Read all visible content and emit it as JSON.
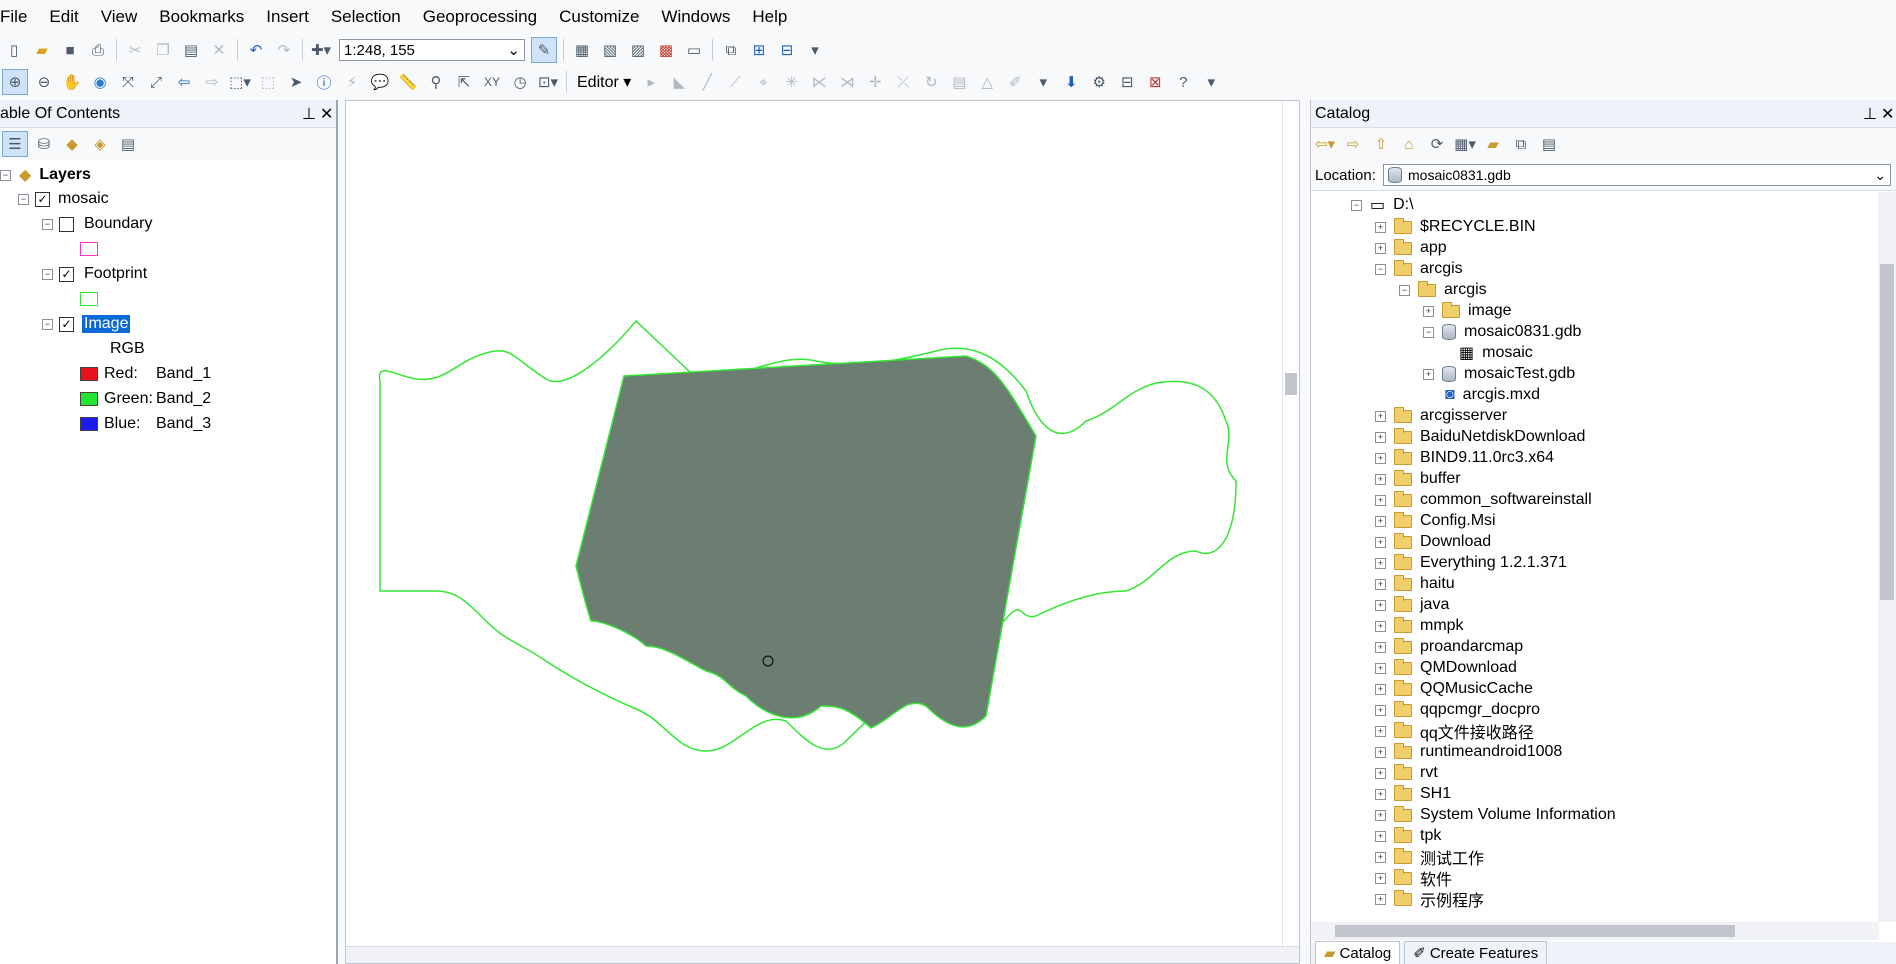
{
  "menu": [
    "File",
    "Edit",
    "View",
    "Bookmarks",
    "Insert",
    "Selection",
    "Geoprocessing",
    "Customize",
    "Windows",
    "Help"
  ],
  "toolbar": {
    "scale": "1:248, 155",
    "editor_label": "Editor"
  },
  "toc": {
    "title": "able Of Contents",
    "layers_label": "Layers",
    "mosaic": "mosaic",
    "boundary": "Boundary",
    "footprint": "Footprint",
    "image": "Image",
    "rgb": "RGB",
    "bands": [
      {
        "label": "Red:",
        "band": "Band_1",
        "color": "#e8101a"
      },
      {
        "label": "Green:",
        "band": "Band_2",
        "color": "#22e630"
      },
      {
        "label": "Blue:",
        "band": "Band_3",
        "color": "#1a1aee"
      }
    ],
    "boundary_color": "#ff33cc",
    "footprint_color": "#33e633"
  },
  "catalog": {
    "title": "Catalog",
    "location_label": "Location:",
    "location_value": "mosaic0831.gdb",
    "tree": [
      {
        "label": "D:\\",
        "type": "drive"
      },
      {
        "label": "$RECYCLE.BIN",
        "type": "folder"
      },
      {
        "label": "app",
        "type": "folder"
      },
      {
        "label": "arcgis",
        "type": "folder"
      },
      {
        "label": "arcgis",
        "type": "folder"
      },
      {
        "label": "image",
        "type": "folder"
      },
      {
        "label": "mosaic0831.gdb",
        "type": "gdb"
      },
      {
        "label": "mosaic",
        "type": "mosaic"
      },
      {
        "label": "mosaicTest.gdb",
        "type": "gdb"
      },
      {
        "label": "arcgis.mxd",
        "type": "mxd"
      },
      {
        "label": "arcgisserver",
        "type": "folder"
      },
      {
        "label": "BaiduNetdiskDownload",
        "type": "folder"
      },
      {
        "label": "BIND9.11.0rc3.x64",
        "type": "folder"
      },
      {
        "label": "buffer",
        "type": "folder"
      },
      {
        "label": "common_softwareinstall",
        "type": "folder"
      },
      {
        "label": "Config.Msi",
        "type": "folder"
      },
      {
        "label": "Download",
        "type": "folder"
      },
      {
        "label": "Everything 1.2.1.371",
        "type": "folder"
      },
      {
        "label": "haitu",
        "type": "folder"
      },
      {
        "label": "java",
        "type": "folder"
      },
      {
        "label": "mmpk",
        "type": "folder"
      },
      {
        "label": "proandarcmap",
        "type": "folder"
      },
      {
        "label": "QMDownload",
        "type": "folder"
      },
      {
        "label": "QQMusicCache",
        "type": "folder"
      },
      {
        "label": "qqpcmgr_docpro",
        "type": "folder"
      },
      {
        "label": "qq文件接收路径",
        "type": "folder"
      },
      {
        "label": "runtimeandroid1008",
        "type": "folder"
      },
      {
        "label": "rvt",
        "type": "folder"
      },
      {
        "label": "SH1",
        "type": "folder"
      },
      {
        "label": "System Volume Information",
        "type": "folder"
      },
      {
        "label": "tpk",
        "type": "folder"
      },
      {
        "label": "测试工作",
        "type": "folder"
      },
      {
        "label": "软件",
        "type": "folder"
      },
      {
        "label": "示例程序",
        "type": "folder"
      }
    ],
    "tab_catalog": "Catalog",
    "tab_create": "Create Features"
  },
  "colors": {
    "selection": "#0a6ad6",
    "footprint_line": "#33e633",
    "imagery": "#6c7e71"
  }
}
